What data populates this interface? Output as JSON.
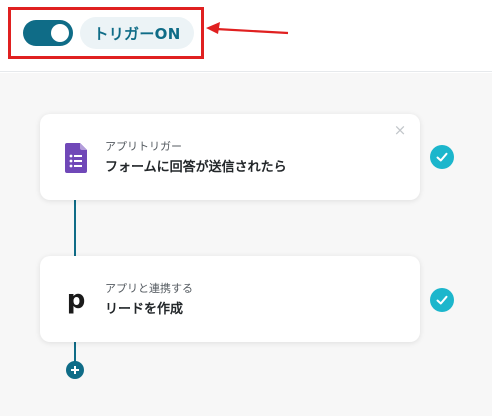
{
  "header": {
    "toggle_state": "on",
    "trigger_label": "トリガーON"
  },
  "colors": {
    "primary": "#0f6c87",
    "highlight": "#e02020",
    "check": "#1cb6cc",
    "forms_purple": "#7048b8"
  },
  "steps": [
    {
      "subtitle": "アプリトリガー",
      "title": "フォームに回答が送信されたら",
      "icon": "google-forms-icon",
      "status": "complete"
    },
    {
      "subtitle": "アプリと連携する",
      "title": "リードを作成",
      "icon": "pipedrive-icon",
      "status": "complete"
    }
  ],
  "icons": {
    "close": "×",
    "pipedrive_glyph": "p"
  }
}
